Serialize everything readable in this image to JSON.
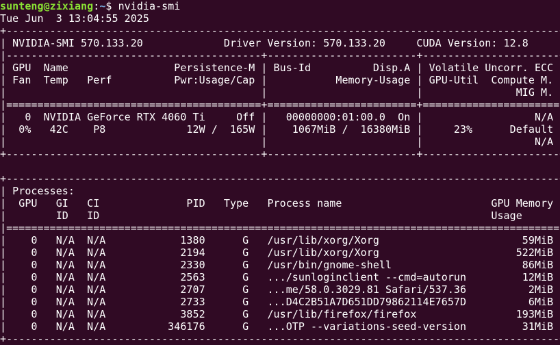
{
  "prompt": {
    "user_host": "sunteng@zixiang",
    "separator": ":",
    "cwd": "~",
    "symbol": "$ ",
    "command": "nvidia-smi"
  },
  "output_lines": [
    "Tue Jun  3 13:04:55 2025",
    "+-----------------------------------------------------------------------------------------+",
    "| NVIDIA-SMI 570.133.20             Driver Version: 570.133.20     CUDA Version: 12.8     |",
    "|-----------------------------------------+------------------------+----------------------+",
    "| GPU  Name                 Persistence-M | Bus-Id          Disp.A | Volatile Uncorr. ECC |",
    "| Fan  Temp   Perf          Pwr:Usage/Cap |           Memory-Usage | GPU-Util  Compute M. |",
    "|                                         |                        |               MIG M. |",
    "|=========================================+========================+======================|",
    "|   0  NVIDIA GeForce RTX 4060 Ti     Off |   00000000:01:00.0  On |                  N/A |",
    "|  0%   42C    P8             12W /  165W |    1067MiB /  16380MiB |     23%      Default |",
    "|                                         |                        |                  N/A |",
    "+-----------------------------------------+------------------------+----------------------+",
    "",
    "+-----------------------------------------------------------------------------------------+",
    "| Processes:                                                                              |",
    "|  GPU   GI   CI              PID   Type   Process name                        GPU Memory |",
    "|        ID   ID                                                               Usage      |",
    "|=========================================================================================|",
    "|    0   N/A  N/A            1380      G   /usr/lib/xorg/Xorg                       59MiB |",
    "|    0   N/A  N/A            2194      G   /usr/lib/xorg/Xorg                      522MiB |",
    "|    0   N/A  N/A            2330      G   /usr/bin/gnome-shell                     86MiB |",
    "|    0   N/A  N/A            2563      G   .../sunloginclient --cmd=autorun         12MiB |",
    "|    0   N/A  N/A            2707      G   ...me/58.0.3029.81 Safari/537.36          2MiB |",
    "|    0   N/A  N/A            2733      G   ...D4C2B51A7D651DD79862114E7657D          6MiB |",
    "|    0   N/A  N/A            3852      G   /usr/lib/firefox/firefox                193MiB |",
    "|    0   N/A  N/A          346176      G   ...OTP --variations-seed-version         31MiB |",
    "+-----------------------------------------------------------------------------------------+"
  ]
}
